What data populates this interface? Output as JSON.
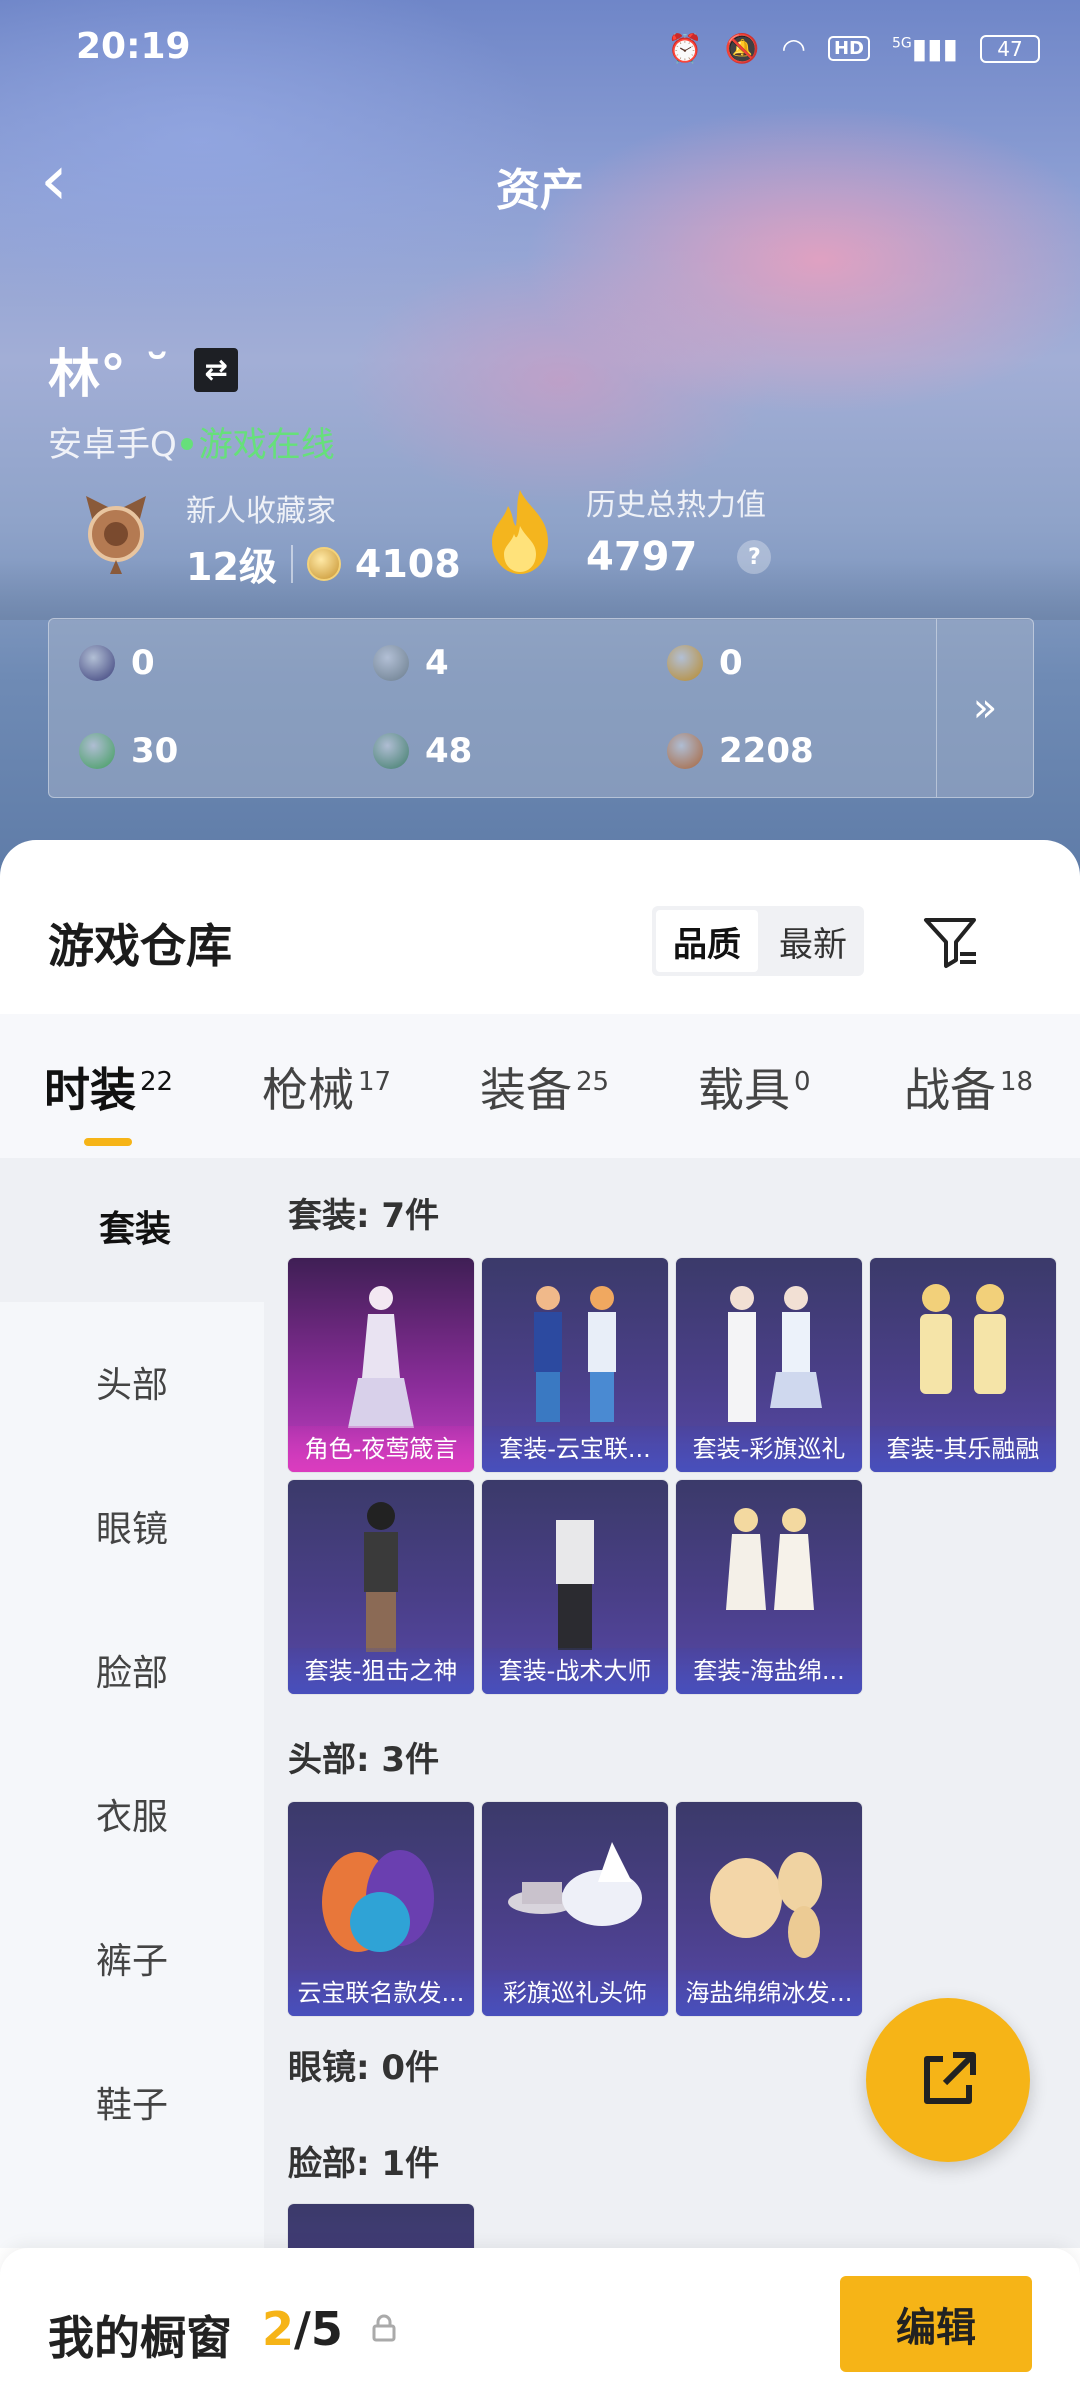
{
  "status": {
    "time": "20:19",
    "hd": "HD",
    "net": "5G",
    "battery": "47"
  },
  "nav": {
    "title": "资产"
  },
  "user": {
    "name": "林° ˘",
    "swap": "⇄",
    "platform": "安卓手Q",
    "online": "游戏在线"
  },
  "collector": {
    "title": "新人收藏家",
    "level": "12级",
    "points": "4108"
  },
  "heat": {
    "title": "历史总热力值",
    "value": "4797",
    "help": "?"
  },
  "stats": [
    {
      "value": "0",
      "icon": "card-icon",
      "color": "#3a3e7a"
    },
    {
      "value": "4",
      "icon": "emblem-icon",
      "color": "#6a7c8c"
    },
    {
      "value": "0",
      "icon": "gold-emblem-icon",
      "color": "#b98a2a"
    },
    {
      "value": "30",
      "icon": "green-card-icon",
      "color": "#3f9d5c"
    },
    {
      "value": "48",
      "icon": "green-orb-icon",
      "color": "#3f7d6a"
    },
    {
      "value": "2208",
      "icon": "bronze-coin-icon",
      "color": "#a8643a"
    }
  ],
  "stats_more": "»",
  "warehouse": {
    "title": "游戏仓库",
    "sort": [
      "品质",
      "最新"
    ]
  },
  "tabs": [
    {
      "label": "时装",
      "count": "22"
    },
    {
      "label": "枪械",
      "count": "17"
    },
    {
      "label": "装备",
      "count": "25"
    },
    {
      "label": "载具",
      "count": "0"
    },
    {
      "label": "战备",
      "count": "18"
    }
  ],
  "side": [
    "套装",
    "头部",
    "眼镜",
    "脸部",
    "衣服",
    "裤子",
    "鞋子"
  ],
  "sections": {
    "suits": {
      "title": "套装: 7件",
      "items": [
        "角色-夜莺箴言",
        "套装-云宝联...",
        "套装-彩旗巡礼",
        "套装-其乐融融",
        "套装-狙击之神",
        "套装-战术大师",
        "套装-海盐绵..."
      ]
    },
    "head": {
      "title": "头部: 3件",
      "items": [
        "云宝联名款发...",
        "彩旗巡礼头饰",
        "海盐绵绵冰发..."
      ]
    },
    "glasses": {
      "title": "眼镜: 0件"
    },
    "face": {
      "title": "脸部: 1件"
    }
  },
  "showcase": {
    "title": "我的橱窗",
    "current": "2",
    "total": "/5",
    "edit": "编辑"
  }
}
